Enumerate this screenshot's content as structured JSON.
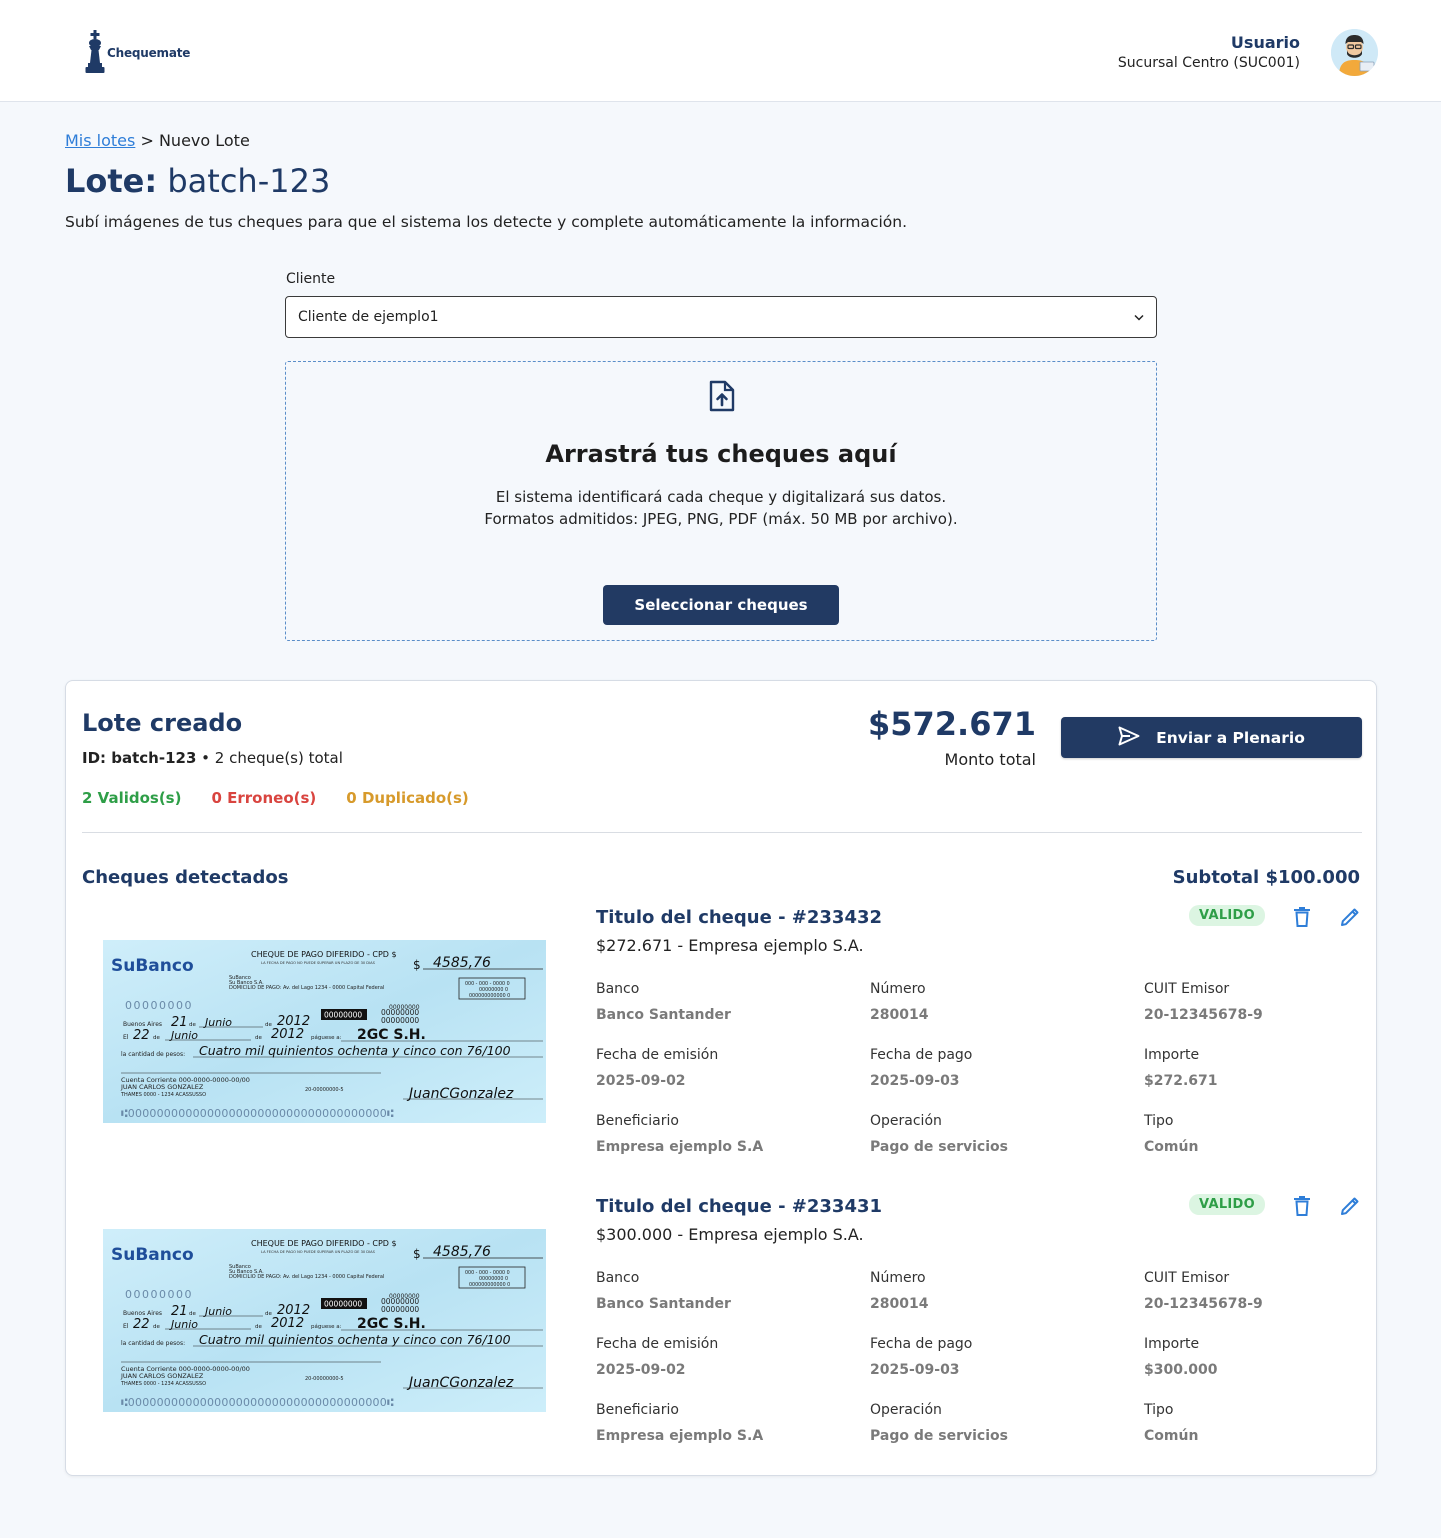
{
  "header": {
    "logo_text": "Chequemate",
    "user_name": "Usuario",
    "user_branch": "Sucursal Centro (SUC001)"
  },
  "breadcrumb": {
    "link": "Mis lotes",
    "separator": ">",
    "current": "Nuevo Lote"
  },
  "page": {
    "title_prefix": "Lote:",
    "title_value": "batch-123",
    "subtitle": "Subí imágenes de tus cheques para que el sistema los detecte y complete automáticamente la información."
  },
  "client": {
    "label": "Cliente",
    "selected": "Cliente de ejemplo1"
  },
  "dropzone": {
    "title": "Arrastrá tus cheques aquí",
    "line1": "El sistema identificará cada cheque y digitalizará sus datos.",
    "line2": "Formatos admitidos: JPEG, PNG, PDF (máx. 50 MB por archivo).",
    "button": "Seleccionar cheques"
  },
  "batch": {
    "title": "Lote creado",
    "id_label": "ID: batch-123",
    "id_suffix": " • 2 cheque(s) total",
    "valid": "2 Validos(s)",
    "error": "0 Erroneo(s)",
    "duplicate": "0 Duplicado(s)",
    "total_amount": "$572.671",
    "total_label": "Monto total",
    "send_button": "Enviar a Plenario",
    "detected_title": "Cheques detectados",
    "subtotal": "Subtotal $100.000"
  },
  "field_labels": {
    "bank": "Banco",
    "number": "Número",
    "cuit": "CUIT Emisor",
    "issue_date": "Fecha de emisión",
    "pay_date": "Fecha de pago",
    "amount": "Importe",
    "beneficiary": "Beneficiario",
    "operation": "Operación",
    "type": "Tipo"
  },
  "cheque_image": {
    "bank_name": "SuBanco",
    "header": "CHEQUE DE PAGO DIFERIDO - CPD $",
    "header_sub": "LA FECHA DE PAGO NO PUEDE SUPERAR UN PLAZO DE 30 DIAS",
    "bank_line1": "SuBanco",
    "bank_line2": "Su Banco S.A.",
    "address": "DOMICILIO DE PAGO: Av. del Lago 1234 - 0000 Capital Federal",
    "amount_symbol": "$",
    "amount": "4585,76",
    "code_box1": "000 - 000 - 0000  0",
    "code_box2": "00000000  0",
    "code_box3": "000000000000  0",
    "serial": "00000000",
    "code_dark": "00000000",
    "code_right": "00000000",
    "code_right2": "00000000",
    "code_right3": "00000000",
    "place": "Buenos Aires",
    "day1": "21",
    "de1": "de",
    "month1": "Junio",
    "de2": "de",
    "year1": "2012",
    "el": "El",
    "day2": "22",
    "de3": "de",
    "month2": "Junio",
    "de4": "de",
    "year2": "2012",
    "payee_label": "páguese a:",
    "payee": "2GC S.H.",
    "words_label": "la cantidad de pesos:",
    "words": "Cuatro mil quinientos ochenta y cinco con 76/100",
    "account": "Cuenta Corriente 000-0000-0000-00/00",
    "holder": "JUAN CARLOS GONZALEZ",
    "holder_address": "THAMES 0000 - 1234 ACASSUSSO",
    "cuit": "20-00000000-5",
    "signature": "JuanCGonzalez",
    "micr": "⑆000000000000000000000000000000000000⑆"
  },
  "cheques": [
    {
      "title": "Titulo del cheque - #233432",
      "subtitle": "$272.671 - Empresa ejemplo S.A.",
      "status": "VALIDO",
      "bank": "Banco Santander",
      "number": "280014",
      "cuit": "20-12345678-9",
      "issue_date": "2025-09-02",
      "pay_date": "2025-09-03",
      "amount": "$272.671",
      "beneficiary": "Empresa ejemplo S.A",
      "operation": "Pago de servicios",
      "type": "Común"
    },
    {
      "title": "Titulo del cheque - #233431",
      "subtitle": "$300.000 - Empresa ejemplo S.A.",
      "status": "VALIDO",
      "bank": "Banco Santander",
      "number": "280014",
      "cuit": "20-12345678-9",
      "issue_date": "2025-09-02",
      "pay_date": "2025-09-03",
      "amount": "$300.000",
      "beneficiary": "Empresa ejemplo S.A",
      "operation": "Pago de servicios",
      "type": "Común"
    }
  ],
  "colors": {
    "primary": "#223a63",
    "title": "#1f3a66",
    "link": "#2f7ed8",
    "valid": "#2e9e47",
    "error": "#d9443f",
    "duplicate": "#d79a2b",
    "action_icon": "#2f7ed8"
  },
  "icons": {
    "logo": "chess-king-icon",
    "upload": "file-upload-icon",
    "dropdown": "chevron-down-icon",
    "send": "paper-plane-icon",
    "delete": "trash-icon",
    "edit": "pencil-icon"
  }
}
